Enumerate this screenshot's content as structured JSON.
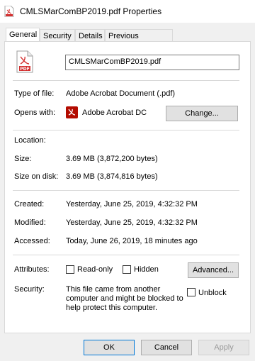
{
  "window": {
    "title": "CMLSMarComBP2019.pdf Properties"
  },
  "tabs": [
    {
      "label": "General"
    },
    {
      "label": "Security"
    },
    {
      "label": "Details"
    },
    {
      "label": "Previous Versions"
    }
  ],
  "general": {
    "file_name": "CMLSMarComBP2019.pdf",
    "type_of_file_label": "Type of file:",
    "type_of_file": "Adobe Acrobat Document (.pdf)",
    "opens_with_label": "Opens with:",
    "opens_with": "Adobe Acrobat DC",
    "change_button": "Change...",
    "location_label": "Location:",
    "location": "",
    "size_label": "Size:",
    "size": "3.69 MB (3,872,200 bytes)",
    "size_on_disk_label": "Size on disk:",
    "size_on_disk": "3.69 MB (3,874,816 bytes)",
    "created_label": "Created:",
    "created": "Yesterday, June 25, 2019, 4:32:32 PM",
    "modified_label": "Modified:",
    "modified": "Yesterday, June 25, 2019, 4:32:32 PM",
    "accessed_label": "Accessed:",
    "accessed": "Today, June 26, 2019, 18 minutes ago",
    "attributes_label": "Attributes:",
    "readonly_label": "Read-only",
    "hidden_label": "Hidden",
    "advanced_button": "Advanced...",
    "security_label": "Security:",
    "security_text_1": "This file came from another",
    "security_text_2": "computer and might be blocked to",
    "security_text_3": "help protect this computer.",
    "unblock_label": "Unblock"
  },
  "footer": {
    "ok": "OK",
    "cancel": "Cancel",
    "apply": "Apply"
  },
  "icons": {
    "pdf_file": "pdf-file-icon",
    "acrobat": "acrobat-icon"
  },
  "colors": {
    "pdf_red": "#d32f2f",
    "acrobat_red": "#b30b00",
    "ok_border": "#0078d7"
  }
}
